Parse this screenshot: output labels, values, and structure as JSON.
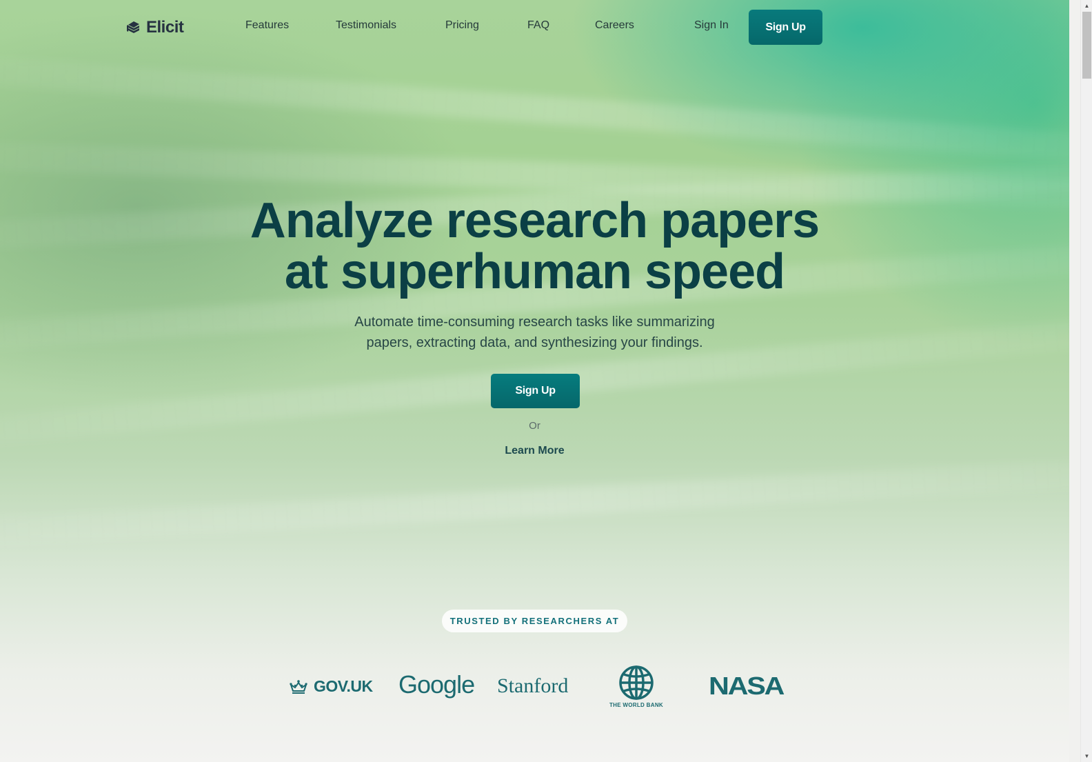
{
  "brand": {
    "name": "Elicit",
    "logo_icon": "stacked-pages-logo-icon"
  },
  "nav": {
    "links": [
      {
        "label": "Features"
      },
      {
        "label": "Testimonials"
      },
      {
        "label": "Pricing"
      },
      {
        "label": "FAQ"
      },
      {
        "label": "Careers"
      }
    ],
    "sign_in": "Sign In",
    "sign_up": "Sign Up"
  },
  "hero": {
    "title_line1": "Analyze research papers",
    "title_line2": "at superhuman speed",
    "subtitle_line1": "Automate time-consuming research tasks like summarizing",
    "subtitle_line2": "papers, extracting data, and synthesizing your findings.",
    "cta_primary": "Sign Up",
    "or_text": "Or",
    "cta_secondary": "Learn More"
  },
  "trusted": {
    "label": "TRUSTED BY RESEARCHERS AT",
    "logos": [
      {
        "name": "GOV.UK",
        "icon": "crown-icon"
      },
      {
        "name": "Google"
      },
      {
        "name": "Stanford"
      },
      {
        "name": "THE WORLD BANK",
        "icon": "globe-icon"
      },
      {
        "name": "NASA"
      }
    ]
  },
  "colors": {
    "accent": "#077a7c",
    "heading": "#0b3f45",
    "logo_teal": "#1c6a70"
  },
  "scrollbar": {
    "up_icon": "scroll-up-arrow-icon",
    "down_icon": "scroll-down-arrow-icon"
  }
}
